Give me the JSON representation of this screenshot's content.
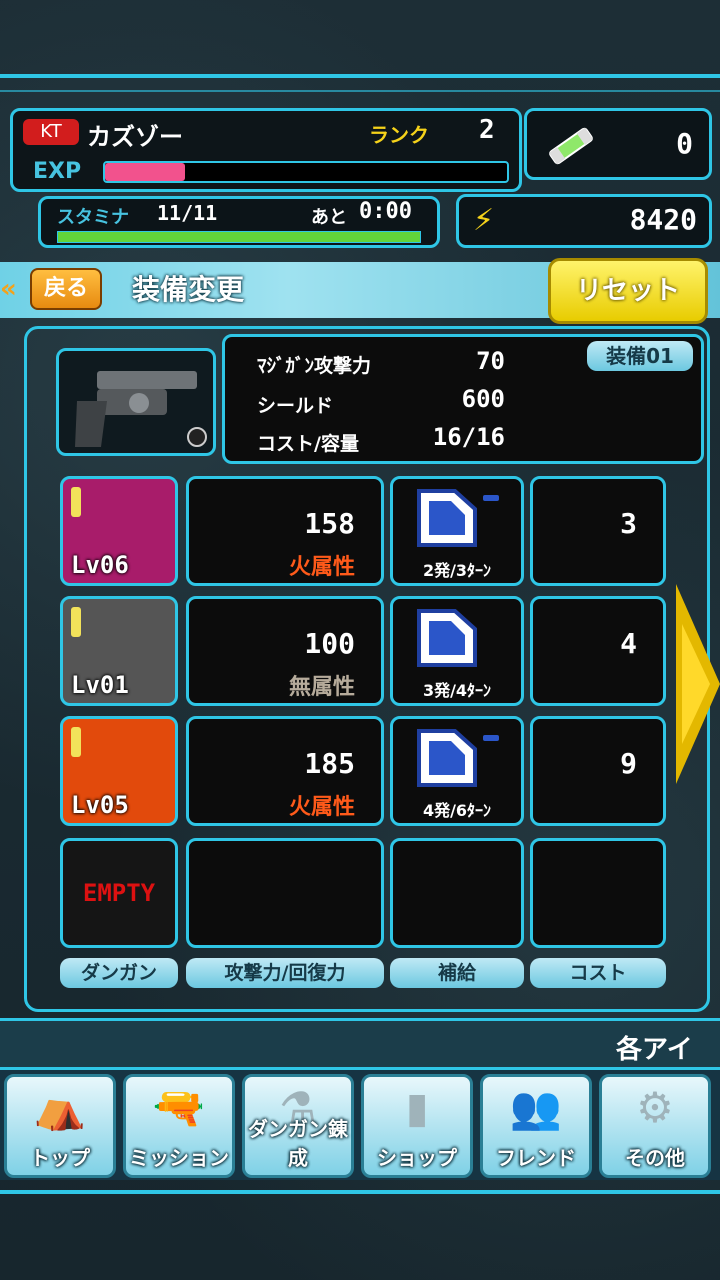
{
  "player": {
    "tag": "KT",
    "name": "カズゾー",
    "rank_label": "ランク",
    "rank_value": "2",
    "exp_label": "EXP",
    "exp_progress": 0.2,
    "stamina_label": "スタミナ",
    "stamina_value": "11/11",
    "recover_label": "あと",
    "recover_time": "0:00",
    "stamina_progress": 1.0,
    "item_count": "0",
    "coins": "8420"
  },
  "titlebar": {
    "back_label": "戻る",
    "title": "装備変更",
    "reset_label": "リセット"
  },
  "weapon": {
    "slot_tag": "装備01",
    "stats": [
      {
        "label": "ﾏｼﾞｶﾞﾝ攻撃力",
        "value": "70"
      },
      {
        "label": "シールド",
        "value": "600"
      },
      {
        "label": "コスト/容量",
        "value": "16/16"
      }
    ]
  },
  "dangans": [
    {
      "level": "Lv06",
      "power": "158",
      "attribute": "火属性",
      "attr_type": "fire",
      "supply": "2発/3ﾀｰﾝ",
      "cost": "3",
      "color": "#a81c6a"
    },
    {
      "level": "Lv01",
      "power": "100",
      "attribute": "無属性",
      "attr_type": "neutral",
      "supply": "3発/4ﾀｰﾝ",
      "cost": "4",
      "color": "#555555"
    },
    {
      "level": "Lv05",
      "power": "185",
      "attribute": "火属性",
      "attr_type": "fire",
      "supply": "4発/6ﾀｰﾝ",
      "cost": "9",
      "color": "#e24a0c"
    }
  ],
  "empty_slot": "EMPTY",
  "columns": [
    "ダンガン",
    "攻撃力/回復力",
    "補給",
    "コスト"
  ],
  "ticker": "各アイ",
  "nav": [
    {
      "label": "トップ",
      "icon": "tent-icon"
    },
    {
      "label": "ミッション",
      "icon": "revolver-icon"
    },
    {
      "label": "ダンガン錬成",
      "icon": "bullet-forge-icon"
    },
    {
      "label": "ショップ",
      "icon": "capsule-icon"
    },
    {
      "label": "フレンド",
      "icon": "friends-icon"
    },
    {
      "label": "その他",
      "icon": "gears-icon"
    }
  ]
}
